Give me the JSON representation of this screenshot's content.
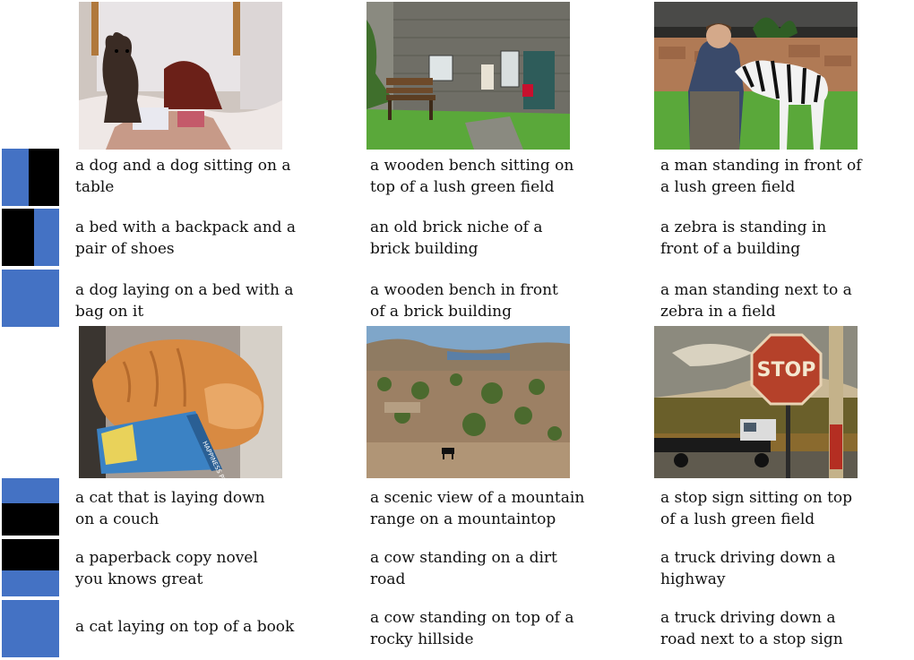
{
  "panels": [
    {
      "images": [
        "dog-on-bed",
        "stone-building-with-bench",
        "man-with-zebra"
      ],
      "attention_masks": [
        {
          "pattern": "blue-left-black-right"
        },
        {
          "pattern": "black-left-blue-right"
        },
        {
          "pattern": "blue"
        }
      ],
      "captions": [
        [
          "a dog and a dog sitting on a\ntable",
          "a wooden bench sitting on\ntop of a lush green field",
          "a man standing in front of\na lush green field"
        ],
        [
          "a bed with a backpack and a\npair of shoes",
          "an old brick niche of a\nbrick building",
          "a zebra is standing in\nfront of a building"
        ],
        [
          "a dog laying on a bed with a\nbag on it",
          "a wooden bench in front\nof a brick building",
          "a man standing next to a\nzebra in a field"
        ]
      ]
    },
    {
      "images": [
        "cat-on-book",
        "mountain-landscape-with-animal",
        "stop-sign-and-truck"
      ],
      "attention_masks": [
        {
          "pattern": "blue-top-black-bottom"
        },
        {
          "pattern": "black-top-blue-bottom"
        },
        {
          "pattern": "blue"
        }
      ],
      "captions": [
        [
          "a cat that is laying down\non a couch",
          "a scenic view of a mountain\nrange on a mountaintop",
          "a stop sign sitting on top\nof a lush green field"
        ],
        [
          "a paperback copy novel\nyou knows great",
          "a cow standing on a dirt\nroad",
          "a truck driving down a\nhighway"
        ],
        [
          "a cat laying on top of a book",
          "a cow standing on top of a\nrocky hillside",
          "a truck driving down a\nroad next to a stop sign"
        ]
      ]
    }
  ],
  "image_text": {
    "stop_sign": "STOP",
    "book_spine": "HAPPINESS PROJECT"
  },
  "colors": {
    "mask_blue": "#4472c4",
    "mask_black": "#000000",
    "grass": "#5aa83a",
    "sky": "#7fa6c9"
  }
}
